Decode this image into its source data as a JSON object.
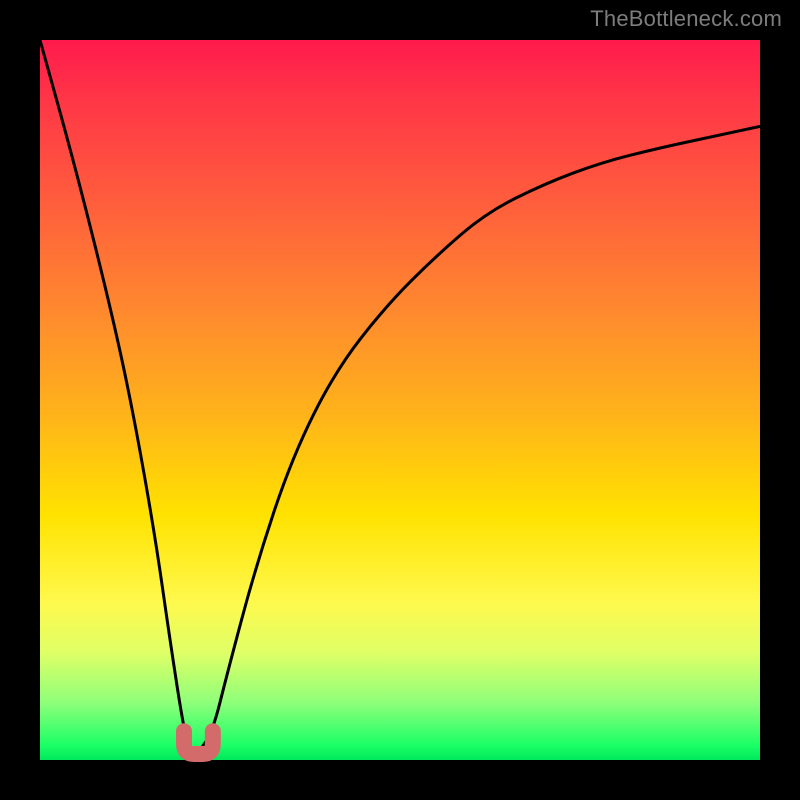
{
  "watermark": "TheBottleneck.com",
  "chart_data": {
    "type": "line",
    "title": "",
    "xlabel": "",
    "ylabel": "",
    "xlim": [
      0,
      100
    ],
    "ylim": [
      0,
      100
    ],
    "grid": false,
    "series": [
      {
        "name": "bottleneck-curve",
        "x": [
          0,
          5,
          10,
          13,
          16,
          18,
          20,
          21,
          22,
          24,
          26,
          30,
          35,
          41,
          48,
          55,
          62,
          70,
          78,
          86,
          93,
          100
        ],
        "values": [
          100,
          82,
          62,
          48,
          31,
          17,
          4,
          1,
          1,
          4,
          12,
          27,
          42,
          54,
          63,
          70,
          76,
          80,
          83,
          85,
          86.5,
          88
        ]
      }
    ],
    "annotations": [
      {
        "name": "trough-marker",
        "shape": "u",
        "x_range": [
          20,
          24
        ],
        "y_range": [
          0,
          4
        ],
        "color": "#d36b6b",
        "stroke_width": 16
      }
    ]
  },
  "colors": {
    "curve": "#000000",
    "trough_marker": "#d36b6b",
    "frame": "#000000",
    "gradient_top": "#ff1a4d",
    "gradient_bottom": "#00e85c",
    "watermark": "#7d7d7d"
  }
}
